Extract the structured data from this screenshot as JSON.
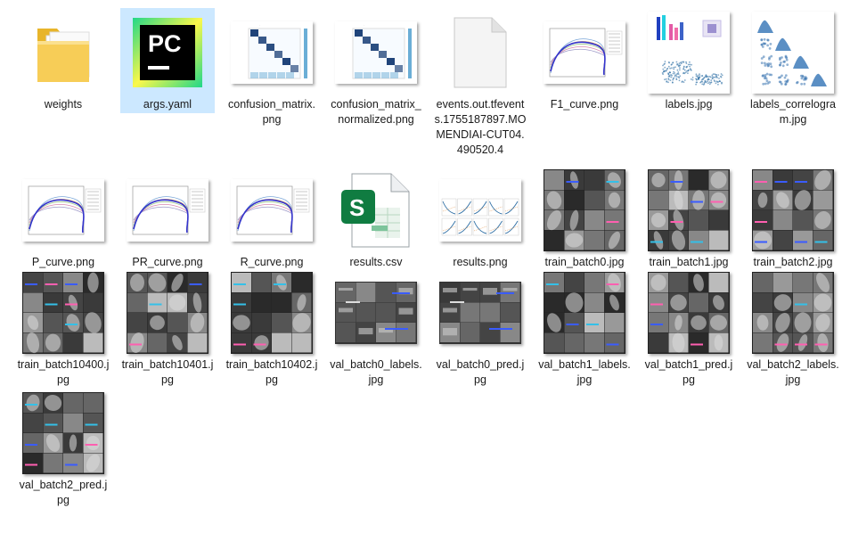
{
  "files": [
    {
      "name": "weights",
      "kind": "folder"
    },
    {
      "name": "args.yaml",
      "kind": "pycharm",
      "selected": true
    },
    {
      "name": "confusion_matrix.png",
      "kind": "confusion"
    },
    {
      "name": "confusion_matrix_normalized.png",
      "kind": "confusion"
    },
    {
      "name": "events.out.tfevents.1755187897.MOMENDIAI-CUT04.490520.4",
      "kind": "blank"
    },
    {
      "name": "F1_curve.png",
      "kind": "curve"
    },
    {
      "name": "labels.jpg",
      "kind": "labels"
    },
    {
      "name": "labels_correlogram.jpg",
      "kind": "correlogram"
    },
    {
      "name": "P_curve.png",
      "kind": "curve"
    },
    {
      "name": "PR_curve.png",
      "kind": "curve"
    },
    {
      "name": "R_curve.png",
      "kind": "curve"
    },
    {
      "name": "results.csv",
      "kind": "csv"
    },
    {
      "name": "results.png",
      "kind": "results"
    },
    {
      "name": "train_batch0.jpg",
      "kind": "batch"
    },
    {
      "name": "train_batch1.jpg",
      "kind": "batch"
    },
    {
      "name": "train_batch2.jpg",
      "kind": "batch"
    },
    {
      "name": "train_batch10400.jpg",
      "kind": "batch"
    },
    {
      "name": "train_batch10401.jpg",
      "kind": "batch"
    },
    {
      "name": "train_batch10402.jpg",
      "kind": "batch"
    },
    {
      "name": "val_batch0_labels.jpg",
      "kind": "val"
    },
    {
      "name": "val_batch0_pred.jpg",
      "kind": "val"
    },
    {
      "name": "val_batch1_labels.jpg",
      "kind": "batch"
    },
    {
      "name": "val_batch1_pred.jpg",
      "kind": "batch"
    },
    {
      "name": "val_batch2_labels.jpg",
      "kind": "batch"
    },
    {
      "name": "val_batch2_pred.jpg",
      "kind": "batch"
    }
  ],
  "icon_text": {
    "pycharm": "PC",
    "csv": "S"
  },
  "colors": {
    "selection": "#cce8ff",
    "folder": "#f5c542",
    "pycharm_green": "#21d789",
    "csv_green": "#107c41"
  }
}
